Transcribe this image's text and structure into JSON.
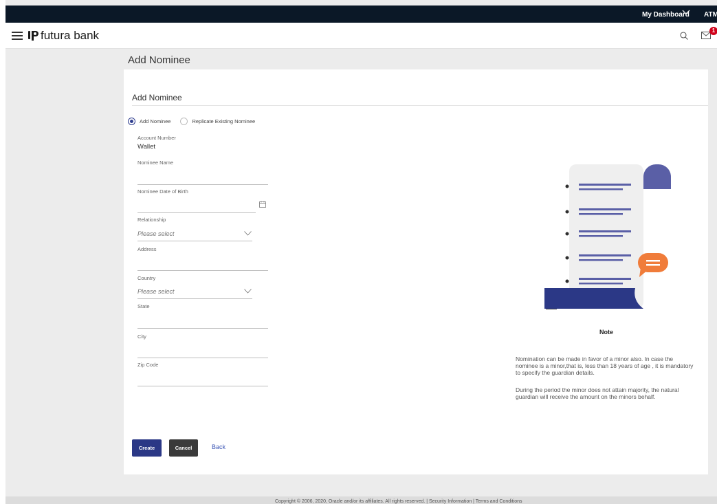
{
  "topbar": {
    "dashboard_label": "My Dashboard",
    "atm_label": "ATM/B"
  },
  "header": {
    "brand": "futura bank",
    "notification_count": "1"
  },
  "page": {
    "title": "Add Nominee"
  },
  "card": {
    "title": "Add Nominee",
    "radio_options": [
      "Add Nominee",
      "Replicate Existing Nominee"
    ],
    "selected_radio": "Add Nominee",
    "account_number_label": "Account Number",
    "account_number_value": "Wallet",
    "nominee_name_label": "Nominee Name",
    "dob_label": "Nominee Date of Birth",
    "relationship_label": "Relationship",
    "relationship_placeholder": "Please select",
    "address_label": "Address",
    "country_label": "Country",
    "country_placeholder": "Please select",
    "state_label": "State",
    "city_label": "City",
    "zip_label": "Zip Code"
  },
  "note": {
    "title": "Note",
    "para1": "Nomination can be made in favor of a minor also. In case the nominee is a minor,that is, less than 18 years of age , it is mandatory to specify the guardian details.",
    "para2": "During the period the minor does not attain majority, the natural guardian will receive the amount on the minors behalf."
  },
  "actions": {
    "create": "Create",
    "cancel": "Cancel",
    "back": "Back"
  },
  "footer": {
    "text": "Copyright © 2006, 2020, Oracle and/or its affiliates. All rights reserved. | Security Information | Terms and Conditions"
  },
  "colors": {
    "accent": "#2b3886",
    "illustration_blue": "#5a5fa6",
    "illustration_orange": "#f07c3a",
    "topbar": "#0b1827"
  }
}
